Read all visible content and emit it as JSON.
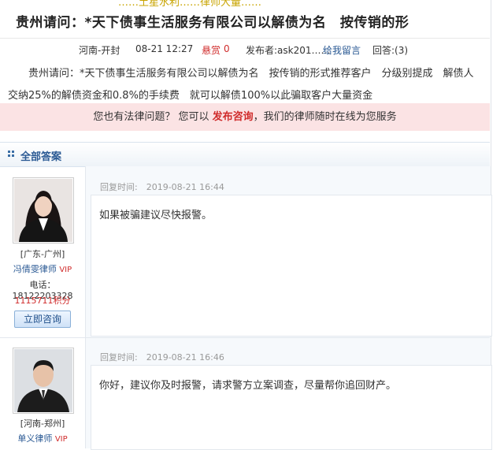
{
  "question": {
    "title": "贵州请问：*天下债事生活服务有限公司以解债为名　按传销的形",
    "location": "河南-开封",
    "date": "08-21 12:27",
    "bounty_label": "悬赏",
    "bounty_value": "0",
    "poster_label": "发布者:ask201……",
    "message_link": "给我留言",
    "replies": "回答:(3)",
    "body_line1": "贵州请问：*天下债事生活服务有限公司以解债为名　按传销的形式推荐客户　分级别提成　解债人",
    "body_line2": "交纳25%的解债资金和0.8%的手续费　就可以解债100%以此骗取客户大量资金"
  },
  "consult_bar": {
    "prefix": "您也有法律问题？ 您可以",
    "link": "发布咨询",
    "suffix": "，我们的律师随时在线为您服务"
  },
  "answers_header": "全部答案",
  "answers": [
    {
      "location": "[广东-广州]",
      "lawyer_name": "冯倩雯律师",
      "vip": "VIP",
      "phone": "电话：18122203328",
      "points": "1115711积分",
      "button": "立即咨询",
      "time": "回复时间:　2019-08-21 16:44",
      "text": "如果被骗建议尽快报警。"
    },
    {
      "location": "[河南-郑州]",
      "lawyer_name": "单义律师",
      "vip": "VIP",
      "time": "回复时间:　2019-08-21 16:46",
      "text": "你好，建议你及时报警，请求警方立案调查，尽量帮你追回财产。"
    }
  ],
  "top_cut_text": "……土星水利……律师大量……"
}
